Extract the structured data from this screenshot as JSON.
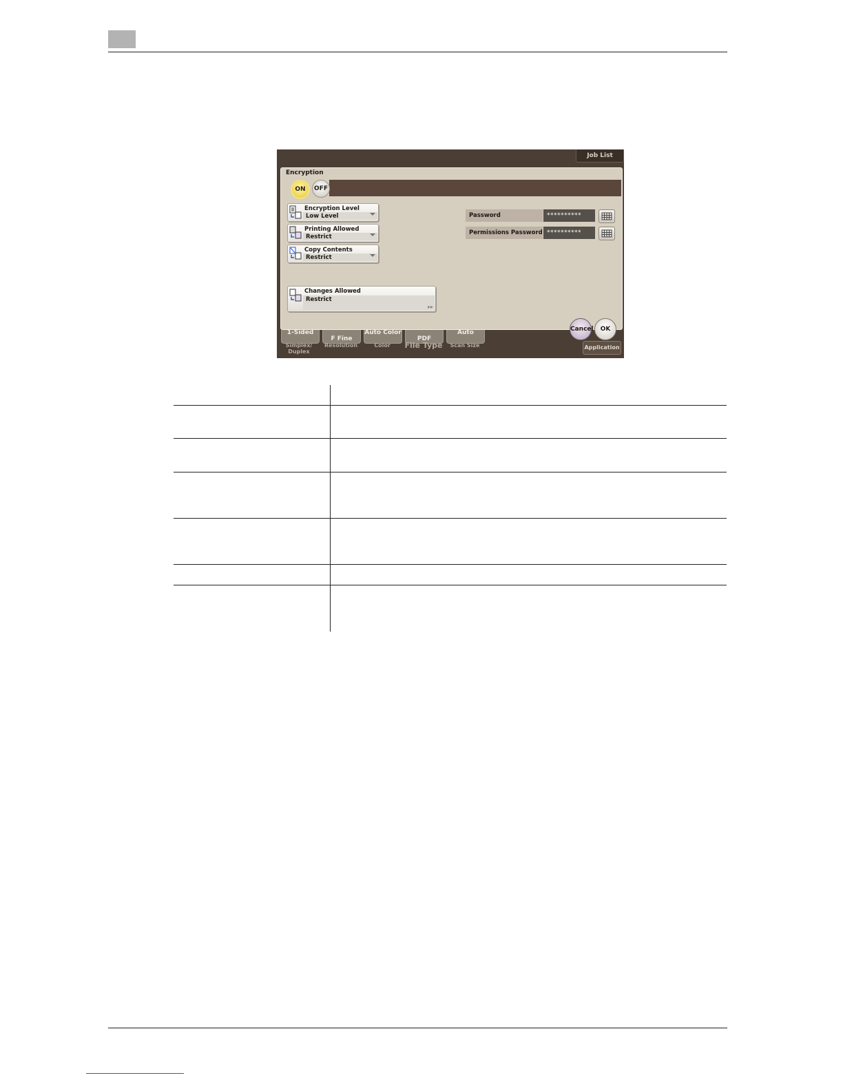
{
  "screen": {
    "top_button": "Job List",
    "dialog": {
      "title": "Encryption",
      "toggle": {
        "on_label": "ON",
        "off_label": "OFF",
        "selected": "ON"
      },
      "encryption_level": {
        "label": "Encryption Level",
        "value": "Low Level"
      },
      "printing_allowed": {
        "label": "Printing Allowed",
        "value": "Restrict"
      },
      "copy_contents": {
        "label": "Copy Contents",
        "value": "Restrict"
      },
      "changes_allowed": {
        "label": "Changes Allowed",
        "value": "Restrict"
      },
      "password": {
        "label": "Password",
        "value": "**********"
      },
      "permissions_password": {
        "label": "Permissions Password",
        "value": "**********"
      },
      "cancel_label": "Cancel",
      "ok_label": "OK"
    },
    "bottom_strip": {
      "simplex": {
        "value": "1-Sided",
        "label": "Simplex/ Duplex"
      },
      "resolution": {
        "value": "F Fine",
        "label": "Resolution"
      },
      "color": {
        "value": "Auto Color",
        "label": "Color"
      },
      "file_type": {
        "value": "PDF",
        "label": "File Type"
      },
      "scan_size": {
        "value": "Auto",
        "label": "Scan Size"
      },
      "application_label": "Application"
    }
  },
  "colors": {
    "screen_bg": "#4b3e34",
    "dialog_bg": "#d6cebf",
    "on_button": "#e8c72a"
  }
}
